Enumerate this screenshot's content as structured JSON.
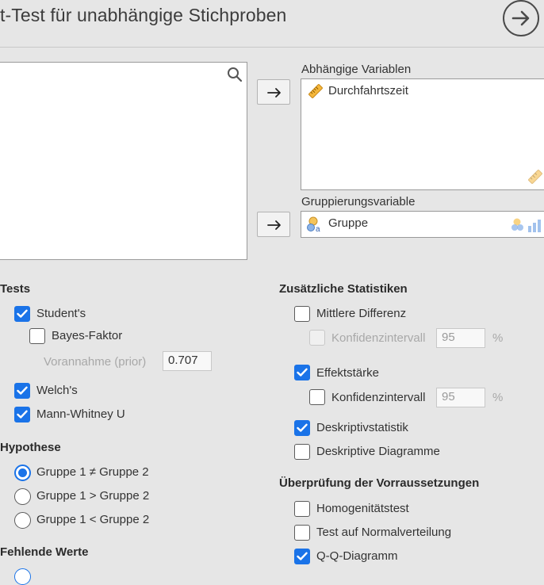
{
  "header": {
    "title": "t-Test für unabhängige Stichproben"
  },
  "variables": {
    "dependent_label": "Abhängige Variablen",
    "dependent_items": [
      "Durchfahrtszeit"
    ],
    "grouping_label": "Gruppierungsvariable",
    "grouping_value": "Gruppe"
  },
  "tests": {
    "title": "Tests",
    "students": {
      "label": "Student's",
      "checked": true
    },
    "bayes": {
      "label": "Bayes-Faktor",
      "checked": false
    },
    "prior": {
      "label": "Vorannahme (prior)",
      "value": "0.707"
    },
    "welchs": {
      "label": "Welch's",
      "checked": true
    },
    "mann_whitney": {
      "label": "Mann-Whitney U",
      "checked": true
    }
  },
  "hypothesis": {
    "title": "Hypothese",
    "options": [
      "Gruppe 1 ≠ Gruppe 2",
      "Gruppe 1 > Gruppe 2",
      "Gruppe 1 < Gruppe 2"
    ],
    "selected": 0
  },
  "missing": {
    "title": "Fehlende Werte"
  },
  "additional": {
    "title": "Zusätzliche Statistiken",
    "mean_diff": {
      "label": "Mittlere Differenz",
      "checked": false
    },
    "ci1": {
      "label": "Konfidenzintervall",
      "value": "95",
      "unit": "%",
      "checked": false,
      "disabled": true
    },
    "effect": {
      "label": "Effektstärke",
      "checked": true
    },
    "ci2": {
      "label": "Konfidenzintervall",
      "value": "95",
      "unit": "%",
      "checked": false
    },
    "descriptives": {
      "label": "Deskriptivstatistik",
      "checked": true
    },
    "desc_plots": {
      "label": "Deskriptive Diagramme",
      "checked": false
    }
  },
  "assumptions": {
    "title": "Überprüfung der Vorraussetzungen",
    "homogeneity": {
      "label": "Homogenitätstest",
      "checked": false
    },
    "normality": {
      "label": "Test auf Normalverteilung",
      "checked": false
    },
    "qq": {
      "label": "Q-Q-Diagramm",
      "checked": true
    }
  },
  "colors": {
    "accent": "#1a73e8",
    "ruler": "#f5b73b",
    "nominal": "#e8a33d",
    "nominal_blue": "#7ea7e0"
  },
  "icons": {
    "run": "arrow-circle-right-icon",
    "search": "search-icon",
    "move": "arrow-right-icon",
    "scale": "ruler-icon",
    "nominal": "nominal-icon"
  }
}
